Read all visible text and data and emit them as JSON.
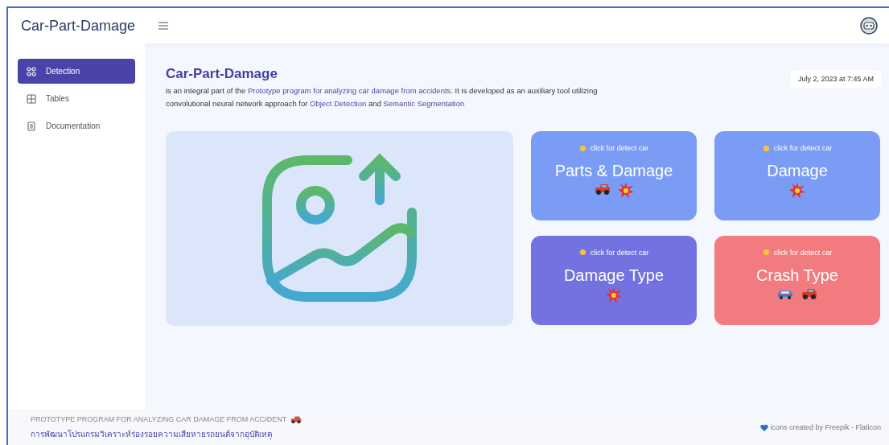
{
  "app": {
    "title": "Car-Part-Damage"
  },
  "sidebar": {
    "items": [
      {
        "label": "Detection",
        "kind": "grid",
        "selected": true
      },
      {
        "label": "Tables",
        "kind": "table",
        "selected": false
      },
      {
        "label": "Documentation",
        "kind": "doc",
        "selected": false
      }
    ]
  },
  "header": {
    "title": "Car-Part-Damage",
    "date": "July 2, 2023 at 7:45 AM",
    "description": [
      {
        "text": "is an integral part of the ",
        "link": false
      },
      {
        "text": "Prototype program for analyzing car damage from accidents.",
        "link": true
      },
      {
        "text": " It is developed as an auxiliary tool utilizing convolutional neural network approach for ",
        "link": false
      },
      {
        "text": "Object Detection",
        "link": true
      },
      {
        "text": " and ",
        "link": false
      },
      {
        "text": "Semantic Segmentation",
        "link": true
      }
    ]
  },
  "cards": [
    {
      "hint": "click for detect car",
      "title": "Parts & Damage",
      "color": "#7a9cf5",
      "emojis": [
        {
          "kind": "car"
        },
        {
          "kind": "burst"
        }
      ]
    },
    {
      "hint": "click for detect car",
      "title": "Damage",
      "color": "#7a9cf5",
      "emojis": [
        {
          "kind": "burst"
        }
      ]
    },
    {
      "hint": "click for detect car",
      "title": "Damage Type",
      "color": "#7273e0",
      "emojis": [
        {
          "kind": "burst"
        }
      ]
    },
    {
      "hint": "click for detect car",
      "title": "Crash Type",
      "color": "#f27b80",
      "emojis": [
        {
          "kind": "sedan"
        },
        {
          "kind": "car"
        }
      ]
    }
  ],
  "footer": {
    "title": "PROTOTYPE PROGRAM FOR ANALYZING CAR DAMAGE FROM ACCIDENT",
    "subtitle": "การพัฒนาโปรแกรมวิเคราะห์ร่องรอยความเสียหายรถยนต์จากอุบัติเหตุ",
    "credit": "icons created by Freepik - Flaticon"
  }
}
